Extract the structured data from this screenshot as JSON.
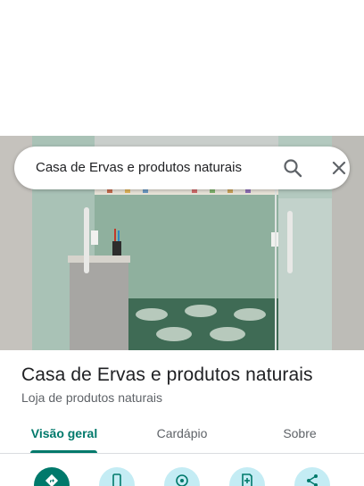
{
  "search": {
    "query": "Casa de Ervas e produtos naturais",
    "search_icon": "search-icon",
    "close_icon": "close-icon"
  },
  "photo": {
    "subject": "storefront-photo"
  },
  "place": {
    "name": "Casa de Ervas e produtos naturais",
    "category": "Loja de produtos naturais"
  },
  "tabs": [
    {
      "label": "Visão geral",
      "active": true
    },
    {
      "label": "Cardápio",
      "active": false
    },
    {
      "label": "Sobre",
      "active": false
    }
  ],
  "actions": [
    {
      "icon": "directions-icon",
      "primary": true
    },
    {
      "icon": "phone-icon",
      "primary": false
    },
    {
      "icon": "location-icon",
      "primary": false
    },
    {
      "icon": "save-icon",
      "primary": false
    },
    {
      "icon": "share-icon",
      "primary": false
    }
  ],
  "colors": {
    "accent": "#00796b",
    "action_bg": "#c4ecf4",
    "muted_text": "#5f6368"
  }
}
